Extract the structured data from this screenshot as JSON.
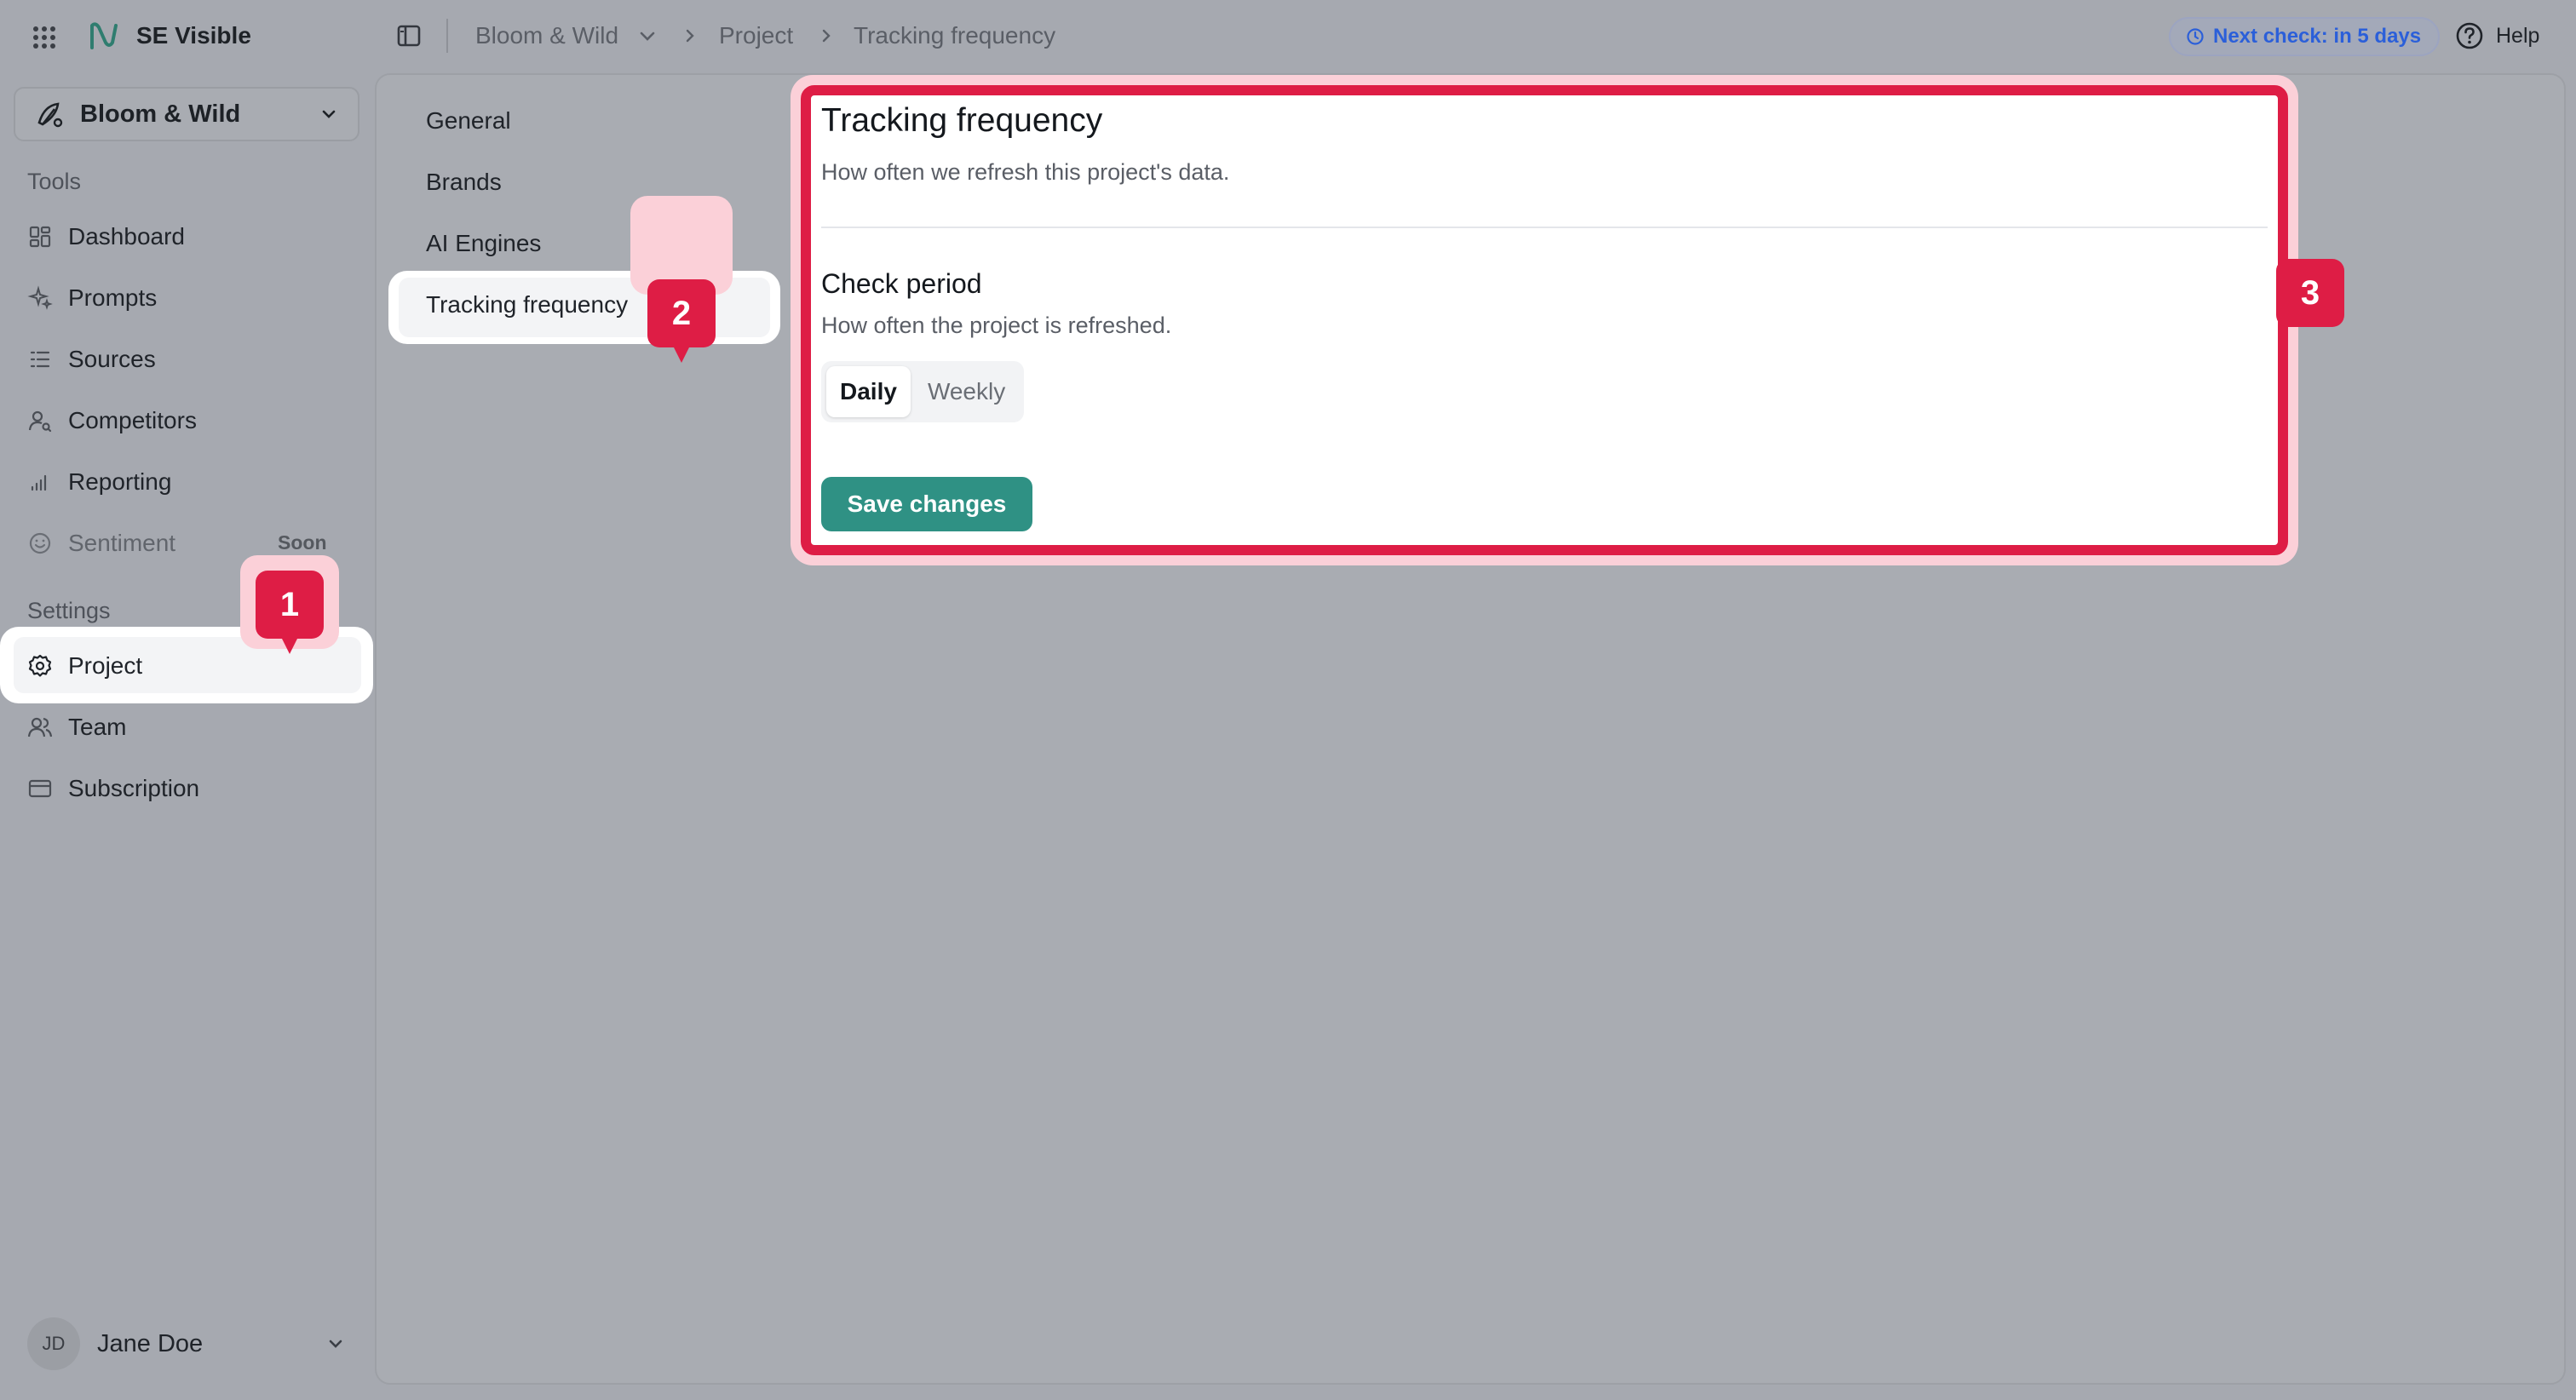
{
  "app": {
    "name": "SE Visible"
  },
  "breadcrumbs": [
    "Bloom & Wild",
    "Project",
    "Tracking frequency"
  ],
  "header": {
    "next_check": "Next check: in 5 days",
    "help": "Help"
  },
  "sidebar": {
    "project_selector": "Bloom & Wild",
    "tools_label": "Tools",
    "tools": [
      {
        "label": "Dashboard",
        "icon": "dashboard-icon"
      },
      {
        "label": "Prompts",
        "icon": "sparkles-icon"
      },
      {
        "label": "Sources",
        "icon": "list-icon"
      },
      {
        "label": "Competitors",
        "icon": "user-search-icon"
      },
      {
        "label": "Reporting",
        "icon": "bar-chart-icon"
      },
      {
        "label": "Sentiment",
        "icon": "smile-icon",
        "badge": "Soon"
      }
    ],
    "settings_label": "Settings",
    "settings": [
      {
        "label": "Project",
        "icon": "gear-icon"
      },
      {
        "label": "Team",
        "icon": "users-icon"
      },
      {
        "label": "Subscription",
        "icon": "credit-card-icon"
      }
    ],
    "user": {
      "initials": "JD",
      "name": "Jane Doe"
    }
  },
  "subnav": [
    "General",
    "Brands",
    "AI Engines",
    "Tracking frequency"
  ],
  "card": {
    "title": "Tracking frequency",
    "subtitle": "How often we refresh this project's data.",
    "section_title": "Check period",
    "section_subtitle": "How often the project is refreshed.",
    "options": [
      "Daily",
      "Weekly"
    ],
    "selected": "Daily",
    "save_label": "Save changes"
  },
  "badges": [
    "1",
    "2",
    "3"
  ],
  "colors": {
    "accent": "#de1d45",
    "primary_button": "#2f9184",
    "link": "#2b5fd9"
  }
}
